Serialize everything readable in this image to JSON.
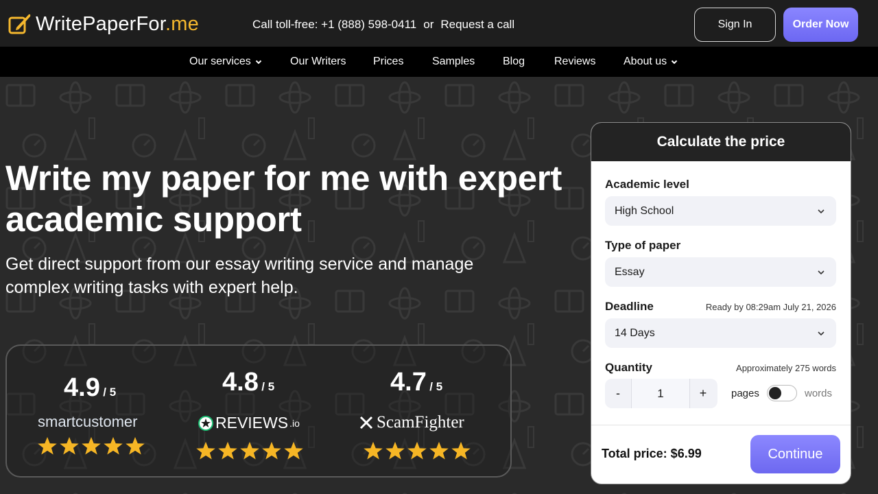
{
  "header": {
    "logo_text_main": "WritePaperFor",
    "logo_text_accent": ".me",
    "phone_label": "Call toll-free: +1 (888) 598-0411",
    "or_text": "or",
    "request_call": "Request a call",
    "signin_label": "Sign In",
    "order_label": "Order Now"
  },
  "nav": {
    "items": [
      {
        "label": "Our services"
      },
      {
        "label": "Our Writers"
      },
      {
        "label": "Prices"
      },
      {
        "label": "Samples"
      },
      {
        "label": "Blog"
      },
      {
        "label": "Reviews"
      },
      {
        "label": "About us"
      }
    ]
  },
  "hero": {
    "title": "Write my paper for me with expert academic support",
    "subtitle": "Get direct support from our essay writing service and manage complex writing tasks with expert help."
  },
  "ratings": [
    {
      "score": "4.9",
      "out_of": "/ 5",
      "brand": "smartcustomer",
      "stars": 5
    },
    {
      "score": "4.8",
      "out_of": "/ 5",
      "brand": "REVIEWS",
      "brand_suffix": ".io",
      "stars": 5
    },
    {
      "score": "4.7",
      "out_of": "/ 5",
      "brand": "ScamFighter",
      "stars": 5
    }
  ],
  "calculator": {
    "title": "Calculate the price",
    "academic_level_label": "Academic level",
    "academic_level_value": "High School",
    "paper_type_label": "Type of paper",
    "paper_type_value": "Essay",
    "deadline_label": "Deadline",
    "deadline_note": "Ready by 08:29am July 21, 2026",
    "deadline_value": "14 Days",
    "quantity_label": "Quantity",
    "quantity_note": "Approximately 275 words",
    "quantity_minus": "-",
    "quantity_value": "1",
    "quantity_plus": "+",
    "unit_pages": "pages",
    "unit_words": "words",
    "total_label": "Total price: $6.99",
    "continue_label": "Continue"
  },
  "colors": {
    "accent": "#7470f8",
    "logo_accent": "#f5b82e",
    "star": "#f6b625"
  }
}
